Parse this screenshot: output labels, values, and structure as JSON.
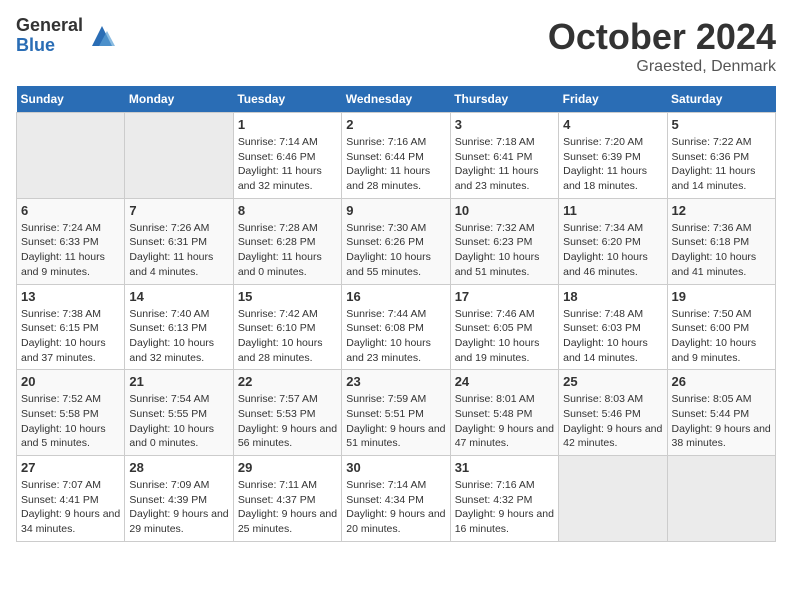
{
  "header": {
    "logo_general": "General",
    "logo_blue": "Blue",
    "month_title": "October 2024",
    "location": "Graested, Denmark"
  },
  "days_of_week": [
    "Sunday",
    "Monday",
    "Tuesday",
    "Wednesday",
    "Thursday",
    "Friday",
    "Saturday"
  ],
  "weeks": [
    [
      {
        "day": "",
        "empty": true
      },
      {
        "day": "",
        "empty": true
      },
      {
        "day": "1",
        "sunrise": "Sunrise: 7:14 AM",
        "sunset": "Sunset: 6:46 PM",
        "daylight": "Daylight: 11 hours and 32 minutes."
      },
      {
        "day": "2",
        "sunrise": "Sunrise: 7:16 AM",
        "sunset": "Sunset: 6:44 PM",
        "daylight": "Daylight: 11 hours and 28 minutes."
      },
      {
        "day": "3",
        "sunrise": "Sunrise: 7:18 AM",
        "sunset": "Sunset: 6:41 PM",
        "daylight": "Daylight: 11 hours and 23 minutes."
      },
      {
        "day": "4",
        "sunrise": "Sunrise: 7:20 AM",
        "sunset": "Sunset: 6:39 PM",
        "daylight": "Daylight: 11 hours and 18 minutes."
      },
      {
        "day": "5",
        "sunrise": "Sunrise: 7:22 AM",
        "sunset": "Sunset: 6:36 PM",
        "daylight": "Daylight: 11 hours and 14 minutes."
      }
    ],
    [
      {
        "day": "6",
        "sunrise": "Sunrise: 7:24 AM",
        "sunset": "Sunset: 6:33 PM",
        "daylight": "Daylight: 11 hours and 9 minutes."
      },
      {
        "day": "7",
        "sunrise": "Sunrise: 7:26 AM",
        "sunset": "Sunset: 6:31 PM",
        "daylight": "Daylight: 11 hours and 4 minutes."
      },
      {
        "day": "8",
        "sunrise": "Sunrise: 7:28 AM",
        "sunset": "Sunset: 6:28 PM",
        "daylight": "Daylight: 11 hours and 0 minutes."
      },
      {
        "day": "9",
        "sunrise": "Sunrise: 7:30 AM",
        "sunset": "Sunset: 6:26 PM",
        "daylight": "Daylight: 10 hours and 55 minutes."
      },
      {
        "day": "10",
        "sunrise": "Sunrise: 7:32 AM",
        "sunset": "Sunset: 6:23 PM",
        "daylight": "Daylight: 10 hours and 51 minutes."
      },
      {
        "day": "11",
        "sunrise": "Sunrise: 7:34 AM",
        "sunset": "Sunset: 6:20 PM",
        "daylight": "Daylight: 10 hours and 46 minutes."
      },
      {
        "day": "12",
        "sunrise": "Sunrise: 7:36 AM",
        "sunset": "Sunset: 6:18 PM",
        "daylight": "Daylight: 10 hours and 41 minutes."
      }
    ],
    [
      {
        "day": "13",
        "sunrise": "Sunrise: 7:38 AM",
        "sunset": "Sunset: 6:15 PM",
        "daylight": "Daylight: 10 hours and 37 minutes."
      },
      {
        "day": "14",
        "sunrise": "Sunrise: 7:40 AM",
        "sunset": "Sunset: 6:13 PM",
        "daylight": "Daylight: 10 hours and 32 minutes."
      },
      {
        "day": "15",
        "sunrise": "Sunrise: 7:42 AM",
        "sunset": "Sunset: 6:10 PM",
        "daylight": "Daylight: 10 hours and 28 minutes."
      },
      {
        "day": "16",
        "sunrise": "Sunrise: 7:44 AM",
        "sunset": "Sunset: 6:08 PM",
        "daylight": "Daylight: 10 hours and 23 minutes."
      },
      {
        "day": "17",
        "sunrise": "Sunrise: 7:46 AM",
        "sunset": "Sunset: 6:05 PM",
        "daylight": "Daylight: 10 hours and 19 minutes."
      },
      {
        "day": "18",
        "sunrise": "Sunrise: 7:48 AM",
        "sunset": "Sunset: 6:03 PM",
        "daylight": "Daylight: 10 hours and 14 minutes."
      },
      {
        "day": "19",
        "sunrise": "Sunrise: 7:50 AM",
        "sunset": "Sunset: 6:00 PM",
        "daylight": "Daylight: 10 hours and 9 minutes."
      }
    ],
    [
      {
        "day": "20",
        "sunrise": "Sunrise: 7:52 AM",
        "sunset": "Sunset: 5:58 PM",
        "daylight": "Daylight: 10 hours and 5 minutes."
      },
      {
        "day": "21",
        "sunrise": "Sunrise: 7:54 AM",
        "sunset": "Sunset: 5:55 PM",
        "daylight": "Daylight: 10 hours and 0 minutes."
      },
      {
        "day": "22",
        "sunrise": "Sunrise: 7:57 AM",
        "sunset": "Sunset: 5:53 PM",
        "daylight": "Daylight: 9 hours and 56 minutes."
      },
      {
        "day": "23",
        "sunrise": "Sunrise: 7:59 AM",
        "sunset": "Sunset: 5:51 PM",
        "daylight": "Daylight: 9 hours and 51 minutes."
      },
      {
        "day": "24",
        "sunrise": "Sunrise: 8:01 AM",
        "sunset": "Sunset: 5:48 PM",
        "daylight": "Daylight: 9 hours and 47 minutes."
      },
      {
        "day": "25",
        "sunrise": "Sunrise: 8:03 AM",
        "sunset": "Sunset: 5:46 PM",
        "daylight": "Daylight: 9 hours and 42 minutes."
      },
      {
        "day": "26",
        "sunrise": "Sunrise: 8:05 AM",
        "sunset": "Sunset: 5:44 PM",
        "daylight": "Daylight: 9 hours and 38 minutes."
      }
    ],
    [
      {
        "day": "27",
        "sunrise": "Sunrise: 7:07 AM",
        "sunset": "Sunset: 4:41 PM",
        "daylight": "Daylight: 9 hours and 34 minutes."
      },
      {
        "day": "28",
        "sunrise": "Sunrise: 7:09 AM",
        "sunset": "Sunset: 4:39 PM",
        "daylight": "Daylight: 9 hours and 29 minutes."
      },
      {
        "day": "29",
        "sunrise": "Sunrise: 7:11 AM",
        "sunset": "Sunset: 4:37 PM",
        "daylight": "Daylight: 9 hours and 25 minutes."
      },
      {
        "day": "30",
        "sunrise": "Sunrise: 7:14 AM",
        "sunset": "Sunset: 4:34 PM",
        "daylight": "Daylight: 9 hours and 20 minutes."
      },
      {
        "day": "31",
        "sunrise": "Sunrise: 7:16 AM",
        "sunset": "Sunset: 4:32 PM",
        "daylight": "Daylight: 9 hours and 16 minutes."
      },
      {
        "day": "",
        "empty": true
      },
      {
        "day": "",
        "empty": true
      }
    ]
  ]
}
